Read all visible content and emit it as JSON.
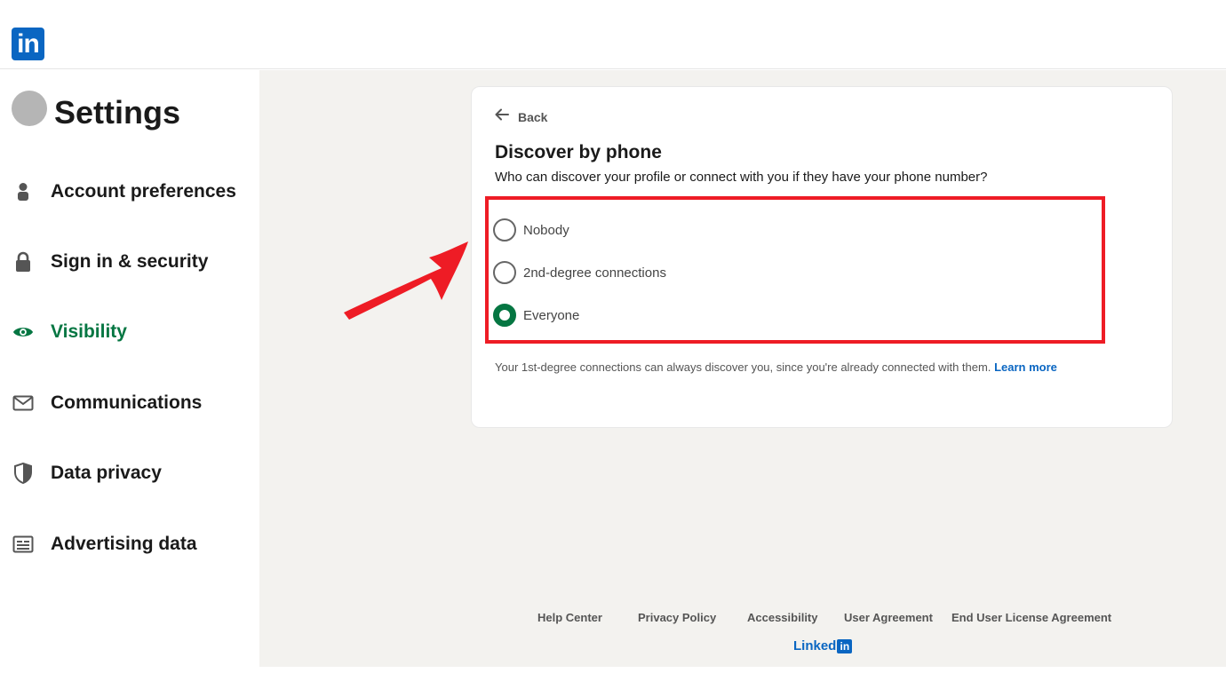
{
  "brand": {
    "logo_text": "in",
    "footer_word": "Linked",
    "footer_box": "in"
  },
  "sidebar": {
    "title": "Settings",
    "items": [
      {
        "label": "Account preferences",
        "icon": "person-icon",
        "active": false
      },
      {
        "label": "Sign in & security",
        "icon": "lock-icon",
        "active": false
      },
      {
        "label": "Visibility",
        "icon": "eye-icon",
        "active": true
      },
      {
        "label": "Communications",
        "icon": "envelope-icon",
        "active": false
      },
      {
        "label": "Data privacy",
        "icon": "shield-icon",
        "active": false
      },
      {
        "label": "Advertising data",
        "icon": "newspaper-icon",
        "active": false
      }
    ]
  },
  "card": {
    "back_label": "Back",
    "title": "Discover by phone",
    "subtitle": "Who can discover your profile or connect with you if they have your phone number?",
    "options": [
      {
        "label": "Nobody",
        "checked": false
      },
      {
        "label": "2nd-degree connections",
        "checked": false
      },
      {
        "label": "Everyone",
        "checked": true
      }
    ],
    "note": "Your 1st-degree connections can always discover you, since you're already connected with them.",
    "learn_more": "Learn more"
  },
  "footer": {
    "links": [
      "Help Center",
      "Privacy Policy",
      "Accessibility",
      "User Agreement",
      "End User License Agreement"
    ]
  },
  "colors": {
    "brand_blue": "#0a66c2",
    "active_green": "#057642",
    "annotation_red": "#ee1c25",
    "main_bg": "#f3f2ef"
  }
}
